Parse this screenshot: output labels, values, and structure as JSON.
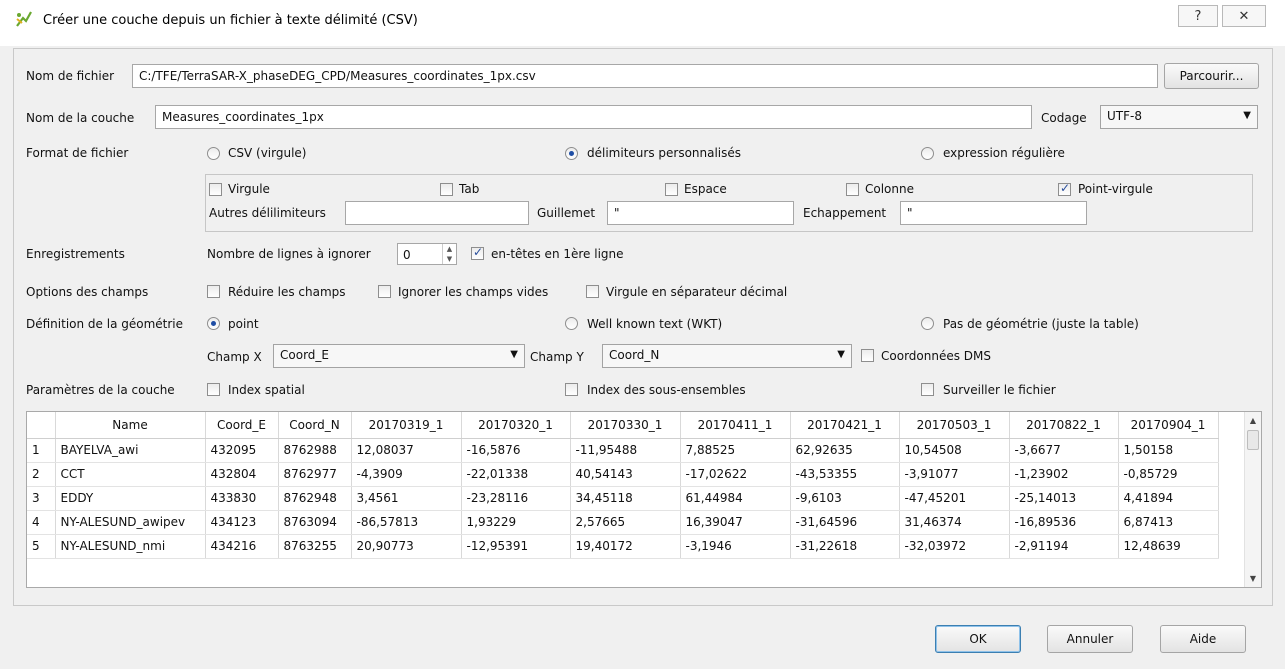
{
  "window": {
    "title": "Créer une couche depuis un fichier à texte délimité (CSV)",
    "help_glyph": "?",
    "close_glyph": "✕"
  },
  "file": {
    "label": "Nom de fichier",
    "value": "C:/TFE/TerraSAR-X_phaseDEG_CPD/Measures_coordinates_1px.csv",
    "browse": "Parcourir..."
  },
  "layer": {
    "label": "Nom de la couche",
    "value": "Measures_coordinates_1px",
    "encoding_label": "Codage",
    "encoding_value": "UTF-8"
  },
  "format": {
    "label": "Format de fichier",
    "options": [
      "CSV (virgule)",
      "délimiteurs personnalisés",
      "expression régulière"
    ],
    "selected": "délimiteurs personnalisés"
  },
  "delimiters": {
    "virgule": "Virgule",
    "tab": "Tab",
    "espace": "Espace",
    "colonne": "Colonne",
    "point_virgule": "Point-virgule",
    "autres_label": "Autres délilimiteurs",
    "autres_value": "",
    "guillemet_label": "Guillemet",
    "guillemet_value": "\"",
    "echappement_label": "Echappement",
    "echappement_value": "\""
  },
  "records": {
    "label": "Enregistrements",
    "skip_label": "Nombre de lignes à ignorer",
    "skip_value": "0",
    "headers_label": "en-têtes en 1ère ligne"
  },
  "field_options": {
    "label": "Options des champs",
    "trim": "Réduire les champs",
    "skip_empty": "Ignorer les champs vides",
    "decimal_comma": "Virgule en séparateur décimal"
  },
  "geometry": {
    "label": "Définition de la géométrie",
    "options": [
      "point",
      "Well known text (WKT)",
      "Pas de géométrie (juste la table)"
    ],
    "selected": "point",
    "x_label": "Champ X",
    "x_value": "Coord_E",
    "y_label": "Champ Y",
    "y_value": "Coord_N",
    "dms": "Coordonnées DMS"
  },
  "layer_params": {
    "label": "Paramètres de la couche",
    "spatial_index": "Index spatial",
    "subset_index": "Index des sous-ensembles",
    "watch_file": "Surveiller le fichier"
  },
  "table": {
    "headers": [
      "Name",
      "Coord_E",
      "Coord_N",
      "20170319_1",
      "20170320_1",
      "20170330_1",
      "20170411_1",
      "20170421_1",
      "20170503_1",
      "20170822_1",
      "20170904_1"
    ],
    "rows": [
      {
        "n": "1",
        "cells": [
          "BAYELVA_awi",
          "432095",
          "8762988",
          "12,08037",
          "-16,5876",
          "-11,95488",
          "7,88525",
          "62,92635",
          "10,54508",
          "-3,6677",
          "1,50158"
        ]
      },
      {
        "n": "2",
        "cells": [
          "CCT",
          "432804",
          "8762977",
          "-4,3909",
          "-22,01338",
          "40,54143",
          "-17,02622",
          "-43,53355",
          "-3,91077",
          "-1,23902",
          "-0,85729"
        ]
      },
      {
        "n": "3",
        "cells": [
          "EDDY",
          "433830",
          "8762948",
          "3,4561",
          "-23,28116",
          "34,45118",
          "61,44984",
          "-9,6103",
          "-47,45201",
          "-25,14013",
          "4,41894"
        ]
      },
      {
        "n": "4",
        "cells": [
          "NY-ALESUND_awipev",
          "434123",
          "8763094",
          "-86,57813",
          "1,93229",
          "2,57665",
          "16,39047",
          "-31,64596",
          "31,46374",
          "-16,89536",
          "6,87413"
        ]
      },
      {
        "n": "5",
        "cells": [
          "NY-ALESUND_nmi",
          "434216",
          "8763255",
          "20,90773",
          "-12,95391",
          "19,40172",
          "-3,1946",
          "-31,22618",
          "-32,03972",
          "-2,91194",
          "12,48639"
        ]
      }
    ]
  },
  "footer": {
    "ok": "OK",
    "cancel": "Annuler",
    "help": "Aide"
  }
}
